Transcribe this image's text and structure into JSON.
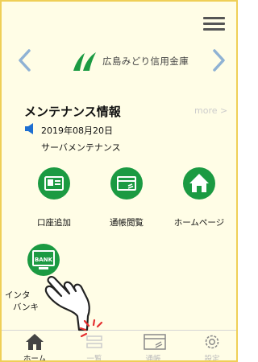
{
  "header": {
    "menu_icon": "hamburger-menu-icon"
  },
  "banner": {
    "bank_name": "広島みどり信用金庫",
    "prev_icon": "chevron-left-icon",
    "next_icon": "chevron-right-icon"
  },
  "maintenance": {
    "title": "メンテナンス情報",
    "more_label": "more >",
    "date": "2019年08月20日",
    "item": "サーバメンテナンス"
  },
  "tiles": [
    {
      "label": "口座追加",
      "icon": "id-card-icon"
    },
    {
      "label": "通帳閲覧",
      "icon": "passbook-icon"
    },
    {
      "label": "ホームページ",
      "icon": "house-icon"
    },
    {
      "label_line1": "インタ",
      "label_line2": "バンキ",
      "icon": "bank-monitor-icon",
      "bank_text": "BANK"
    }
  ],
  "tab_bar": {
    "tabs": [
      {
        "label": "ホーム",
        "icon": "home-icon",
        "active": true
      },
      {
        "label": "一覧",
        "icon": "list-icon",
        "active": false
      },
      {
        "label": "通帳",
        "icon": "passbook-icon",
        "active": false
      },
      {
        "label": "設定",
        "icon": "gear-icon",
        "active": false
      }
    ]
  },
  "colors": {
    "accent_green": "#1b9a42",
    "frame": "#efcf57",
    "background": "#fffde6",
    "arrow": "#8fb2d4",
    "speaker": "#1e6fd1"
  }
}
